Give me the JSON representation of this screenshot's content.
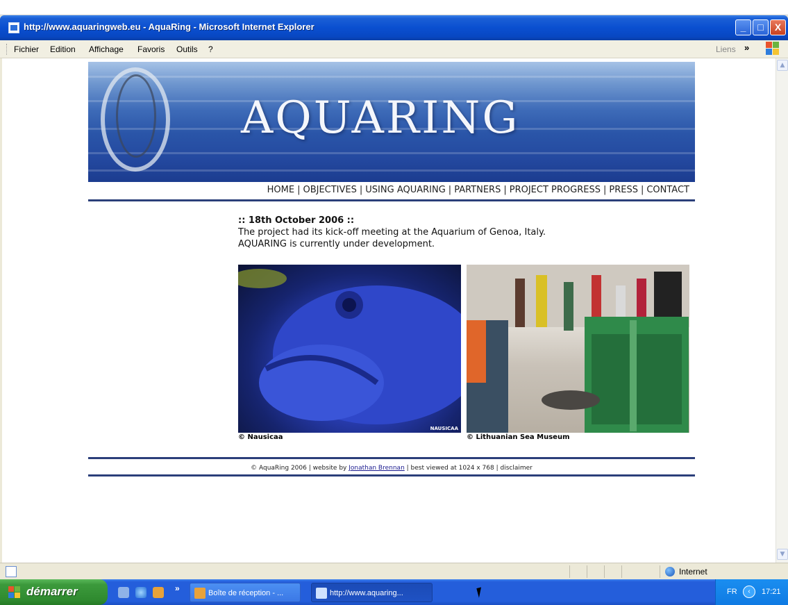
{
  "window": {
    "title": "http://www.aquaringweb.eu - AquaRing - Microsoft Internet Explorer",
    "minimize": "_",
    "maximize": "□",
    "close": "X"
  },
  "menubar": {
    "items": [
      "Fichier",
      "Edition",
      "Affichage",
      "Favoris",
      "Outils",
      "?"
    ],
    "links_label": "Liens",
    "chevron": "»"
  },
  "page": {
    "banner_title": "AQUARING",
    "nav": [
      "HOME",
      "OBJECTIVES",
      "USING AQUARING",
      "PARTNERS",
      "PROJECT PROGRESS",
      "PRESS",
      "CONTACT"
    ],
    "nav_separator": "|",
    "news": {
      "date": ":: 18th October 2006 ::",
      "line1": "The project had its kick-off meeting at the Aquarium of Genoa, Italy.",
      "line2": "AQUARING is currently under development."
    },
    "photos": [
      {
        "caption": "© Nausicaa",
        "watermark": "NAUSICAA"
      },
      {
        "caption": "© Lithuanian Sea Museum"
      }
    ],
    "footer": {
      "copyright": "© AquaRing 2006 | website by ",
      "author_link": "Jonathan Brennan",
      "rest": " | best viewed at 1024 x 768 | disclaimer"
    }
  },
  "statusbar": {
    "zone": "Internet"
  },
  "taskbar": {
    "start_label": "démarrer",
    "quicklaunch_chevron": "»",
    "tasks": [
      {
        "label": "Boîte de réception - ..."
      },
      {
        "label": "http://www.aquaring..."
      }
    ],
    "language": "FR",
    "tray_chevron": "‹",
    "clock": "17:21"
  },
  "colors": {
    "titlebar": "#0a4fd0",
    "nav_rule": "#2b3f7a",
    "start_button": "#3c9a3c",
    "taskbar": "#245edb"
  }
}
